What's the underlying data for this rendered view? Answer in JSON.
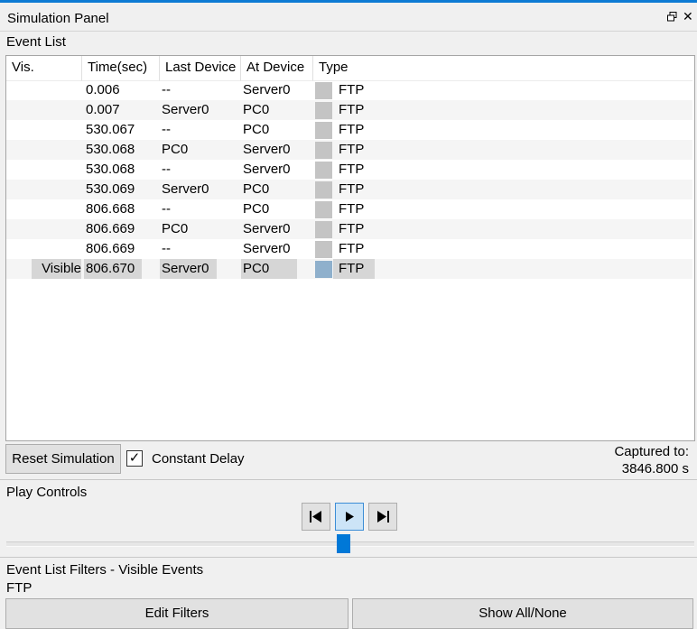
{
  "panel": {
    "title": "Simulation Panel"
  },
  "event_list": {
    "label": "Event List",
    "columns": [
      "Vis.",
      "Time(sec)",
      "Last Device",
      "At Device",
      "Type"
    ],
    "rows": [
      {
        "vis": "",
        "time": "0.006",
        "last": "--",
        "at": "Server0",
        "type": "FTP",
        "color": "#c4c4c4"
      },
      {
        "vis": "",
        "time": "0.007",
        "last": "Server0",
        "at": "PC0",
        "type": "FTP",
        "color": "#c4c4c4"
      },
      {
        "vis": "",
        "time": "530.067",
        "last": "--",
        "at": "PC0",
        "type": "FTP",
        "color": "#c4c4c4"
      },
      {
        "vis": "",
        "time": "530.068",
        "last": "PC0",
        "at": "Server0",
        "type": "FTP",
        "color": "#c4c4c4"
      },
      {
        "vis": "",
        "time": "530.068",
        "last": "--",
        "at": "Server0",
        "type": "FTP",
        "color": "#c4c4c4"
      },
      {
        "vis": "",
        "time": "530.069",
        "last": "Server0",
        "at": "PC0",
        "type": "FTP",
        "color": "#c4c4c4"
      },
      {
        "vis": "",
        "time": "806.668",
        "last": "--",
        "at": "PC0",
        "type": "FTP",
        "color": "#c4c4c4"
      },
      {
        "vis": "",
        "time": "806.669",
        "last": "PC0",
        "at": "Server0",
        "type": "FTP",
        "color": "#c4c4c4"
      },
      {
        "vis": "",
        "time": "806.669",
        "last": "--",
        "at": "Server0",
        "type": "FTP",
        "color": "#c4c4c4"
      },
      {
        "vis": "Visible",
        "time": "806.670",
        "last": "Server0",
        "at": "PC0",
        "type": "FTP",
        "color": "#8fb0cc"
      }
    ]
  },
  "controls": {
    "reset_label": "Reset Simulation",
    "constant_delay_label": "Constant Delay",
    "constant_delay_checked": true,
    "captured_label": "Captured to:",
    "captured_value": "3846.800 s"
  },
  "play_controls": {
    "label": "Play Controls",
    "buttons": [
      "back-step-icon",
      "play-icon",
      "forward-step-icon"
    ],
    "active_button": "play-icon",
    "slider_position": 0.49
  },
  "filters": {
    "label": "Event List Filters - Visible Events",
    "value": "FTP",
    "edit_label": "Edit Filters",
    "show_all_label": "Show All/None"
  },
  "colors": {
    "accent": "#0078d7",
    "selection": "#d6d6d6",
    "swatch": "#c4c4c4"
  }
}
